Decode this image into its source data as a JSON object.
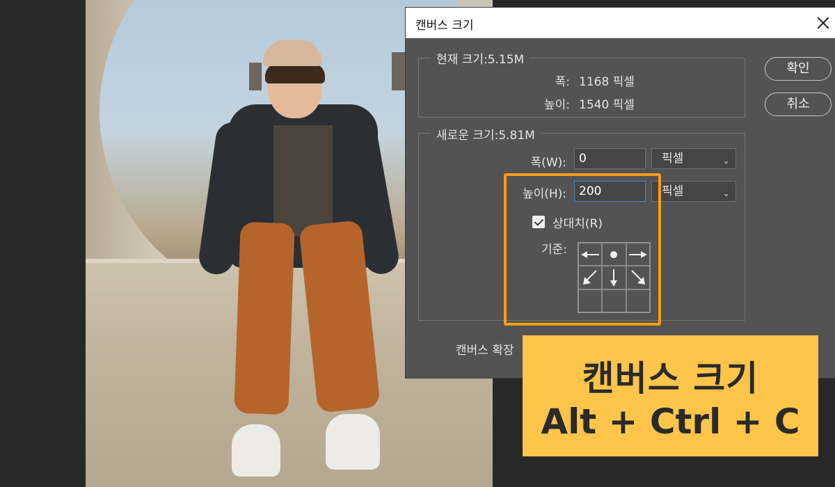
{
  "dialog": {
    "title": "캔버스 크기",
    "current": {
      "legend": "현재 크기:5.15M",
      "width_label": "폭:",
      "width_value": "1168 픽셀",
      "height_label": "높이:",
      "height_value": "1540 픽셀"
    },
    "new": {
      "legend": "새로운 크기:5.81M",
      "width_label": "폭(W):",
      "width_value": "0",
      "width_unit": "픽셀",
      "height_label": "높이(H):",
      "height_value": "200",
      "height_unit": "픽셀",
      "relative_label": "상대치(R)",
      "relative_checked": true,
      "anchor_label": "기준:"
    },
    "extension_label": "캔버스 확장",
    "ok_label": "확인",
    "cancel_label": "취소"
  },
  "anchor": {
    "cells": [
      "arrow-left",
      "dot",
      "arrow-right",
      "arrow-down-left",
      "arrow-down",
      "arrow-down-right",
      "empty",
      "empty",
      "empty"
    ]
  },
  "overlay": {
    "line1": "캔버스 크기",
    "line2": "Alt + Ctrl + C"
  },
  "colors": {
    "dialog_bg": "#535353",
    "highlight": "#f79b16",
    "badge": "#ffc54a"
  }
}
